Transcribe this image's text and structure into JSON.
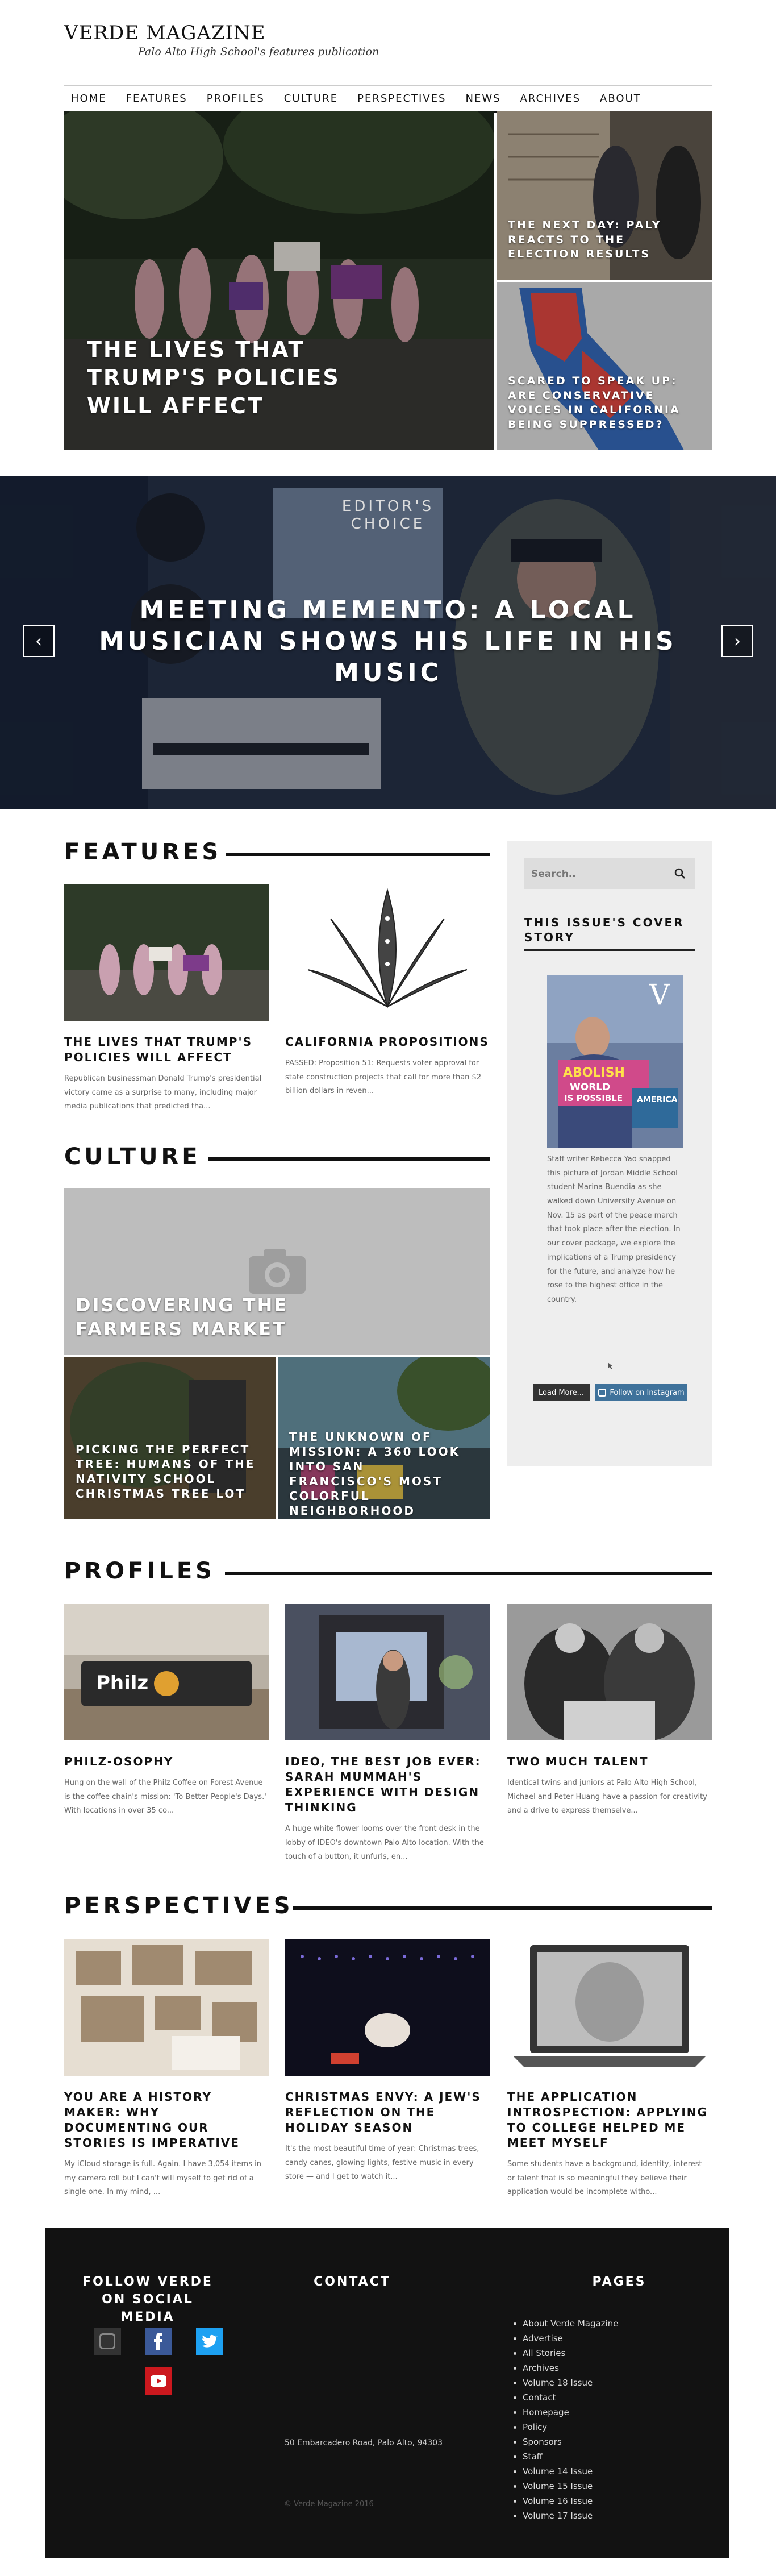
{
  "site": {
    "title": "VERDE MAGAZINE",
    "subtitle": "Palo Alto High School's features publication"
  },
  "nav": [
    "HOME",
    "FEATURES",
    "PROFILES",
    "CULTURE",
    "PERSPECTIVES",
    "NEWS",
    "ARCHIVES",
    "ABOUT"
  ],
  "hero": {
    "main": "THE LIVES THAT TRUMP'S POLICIES WILL AFFECT",
    "top_right": "THE NEXT DAY: PALY REACTS TO THE ELECTION RESULTS",
    "bottom_right": "SCARED TO SPEAK UP: ARE CONSERVATIVE VOICES IN CALIFORNIA BEING SUPPRESSED?"
  },
  "slider": {
    "badge": "EDITOR'S CHOICE",
    "title": "MEETING MEMENTO: A LOCAL MUSICIAN SHOWS HIS LIFE IN HIS MUSIC",
    "prev": "‹",
    "next": "›"
  },
  "features": {
    "heading": "FEATURES",
    "cards": [
      {
        "title": "THE LIVES THAT TRUMP'S POLICIES WILL AFFECT",
        "excerpt": "Republican businessman Donald Trump's presidential victory came as a surprise to many, including major media publications that predicted tha..."
      },
      {
        "title": "CALIFORNIA PROPOSITIONS",
        "excerpt": "PASSED: Proposition 51: Requests voter approval for state construction projects that call for more than $2 billion dollars in reven..."
      }
    ]
  },
  "culture": {
    "heading": "CULTURE",
    "big": "DISCOVERING THE FARMERS MARKET",
    "small": [
      "PICKING THE PERFECT TREE: HUMANS OF THE NATIVITY SCHOOL CHRISTMAS TREE LOT",
      "THE UNKNOWN OF MISSION: A 360 LOOK INTO SAN FRANCISCO'S MOST COLORFUL NEIGHBORHOOD"
    ]
  },
  "sidebar": {
    "search_placeholder": "Search..",
    "cover_heading": "THIS ISSUE'S COVER STORY",
    "cover_v": "V",
    "cover_sign_1": "ABOLISH",
    "cover_sign_2": "WORLD",
    "cover_sign_3": "IS POSSIBLE",
    "cover_side": "AMERICA",
    "cover_text": "Staff writer Rebecca Yao snapped this picture of Jordan Middle School student Marina Buendia as she walked down University Avenue on Nov. 15 as part of the peace march that took place after the election. In our cover package, we explore the implications of a Trump presidency for the future, and analyze how he rose to the highest office in the country.",
    "load_more": "Load More...",
    "instagram": "Follow on Instagram"
  },
  "profiles": {
    "heading": "PROFILES",
    "cards": [
      {
        "title": "PHILZ-OSOPHY",
        "sign": "Philz",
        "excerpt": "Hung on the wall of the Philz Coffee on Forest Avenue is the coffee chain's mission: 'To Better People's Days.' With locations in over 35 co..."
      },
      {
        "title": "IDEO, THE BEST JOB EVER: SARAH MUMMAH'S EXPERIENCE WITH DESIGN THINKING",
        "excerpt": "A huge white flower looms over the front desk in the lobby of IDEO's downtown Palo Alto location. With the touch of a button, it unfurls, en..."
      },
      {
        "title": "TWO MUCH TALENT",
        "excerpt": "Identical twins and juniors at Palo Alto High School, Michael and Peter Huang have a passion for creativity and a drive to express themselve..."
      }
    ]
  },
  "perspectives": {
    "heading": "PERSPECTIVES",
    "cards": [
      {
        "title": "YOU ARE A HISTORY MAKER: WHY DOCUMENTING OUR STORIES IS IMPERATIVE",
        "excerpt": "My iCloud storage is full. Again. I have 3,054 items in my camera roll but I can't will myself to get rid of a single one. In my mind, ..."
      },
      {
        "title": "CHRISTMAS ENVY: A JEW'S REFLECTION ON THE HOLIDAY SEASON",
        "excerpt": "It's the most beautiful time of year: Christmas trees, candy canes, glowing lights, festive music in every store — and I get to watch it..."
      },
      {
        "title": "THE APPLICATION INTROSPECTION: APPLYING TO COLLEGE HELPED ME MEET MYSELF",
        "excerpt": "Some students have a background, identity, interest or talent that is so meaningful they believe their application would be incomplete witho..."
      }
    ]
  },
  "footer": {
    "social_heading": "FOLLOW VERDE ON SOCIAL MEDIA",
    "contact_heading": "CONTACT",
    "address": "50 Embarcadero Road, Palo Alto, 94303",
    "copyright": "© Verde Magazine 2016",
    "pages_heading": "PAGES",
    "pages": [
      "About Verde Magazine",
      "Advertise",
      "All Stories",
      "Archives",
      "Volume 18 Issue",
      "Contact",
      "Homepage",
      "Policy",
      "Sponsors",
      "Staff",
      "Volume 14 Issue",
      "Volume 15 Issue",
      "Volume 16 Issue",
      "Volume 17 Issue"
    ]
  },
  "colors": {
    "accent": "#111111",
    "facebook": "#3b5998",
    "twitter": "#1da1f2",
    "youtube": "#cc181e",
    "instagram": "#3f729b"
  }
}
